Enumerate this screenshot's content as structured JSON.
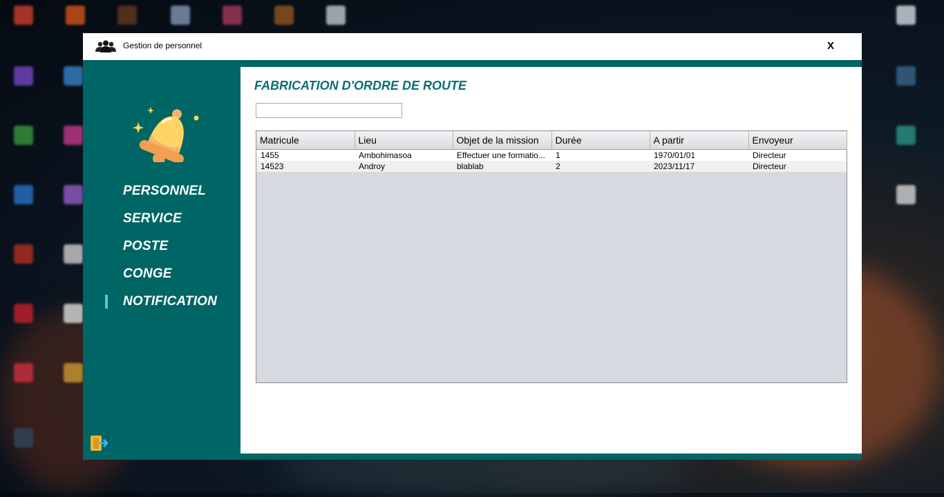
{
  "window": {
    "title": "Gestion de personnel",
    "close_label": "X"
  },
  "sidebar": {
    "items": [
      {
        "label": "PERSONNEL"
      },
      {
        "label": "SERVICE"
      },
      {
        "label": "POSTE"
      },
      {
        "label": "CONGE"
      },
      {
        "label": "NOTIFICATION",
        "active": true
      }
    ]
  },
  "main": {
    "title": "FABRICATION D'ORDRE DE ROUTE",
    "search": {
      "value": "",
      "placeholder": ""
    },
    "table": {
      "columns": [
        "Matricule",
        "Lieu",
        "Objet de la mission",
        "Durée",
        "A partir",
        "Envoyeur"
      ],
      "rows": [
        [
          "1455",
          "Ambohimasoa",
          "Effectuer une formatio...",
          "1",
          "1970/01/01",
          "Directeur"
        ],
        [
          "14523",
          "Androy",
          "blablab",
          "2",
          "2023/11/17",
          "Directeur"
        ]
      ]
    }
  },
  "colors": {
    "sidebar": "#006565",
    "title_text": "#0b6f73",
    "active_indicator": "#3fd6cf",
    "table_empty": "#d6d9e0"
  },
  "icons": {
    "app": "users-icon",
    "hero": "bell-icon",
    "exit": "exit-door-icon"
  }
}
